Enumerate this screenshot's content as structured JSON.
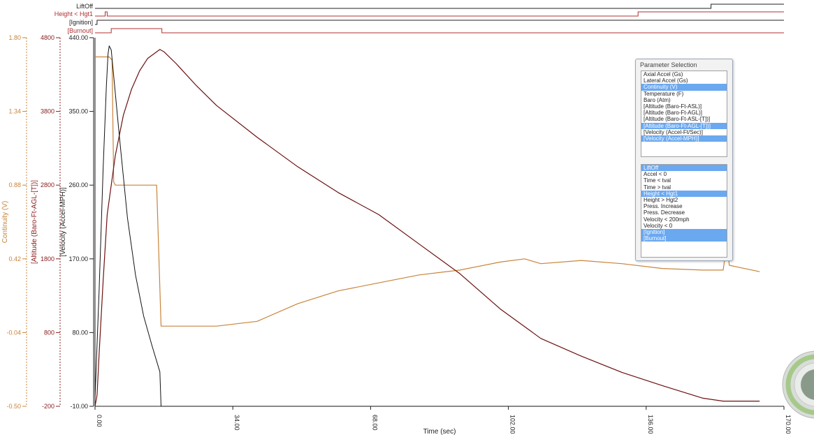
{
  "events": [
    {
      "label": "LiftOff",
      "color": "#222222"
    },
    {
      "label": "Height < Hgt1",
      "color": "#b03030"
    },
    {
      "label": "[Ignition]",
      "color": "#222222"
    },
    {
      "label": "[Burnout]",
      "color": "#b03030"
    }
  ],
  "chart_data": {
    "type": "line",
    "xlabel": "Time (sec)",
    "xlim": [
      0,
      170
    ],
    "xticks": [
      "0.00",
      "34.00",
      "68.00",
      "102.00",
      "136.00",
      "170.00"
    ],
    "axes": [
      {
        "name": "Continuity (V)",
        "color": "#c8843a",
        "ylim": [
          -0.5,
          1.8
        ],
        "ticks": [
          "-0.50",
          "-0.04",
          "0.42",
          "0.88",
          "1.34",
          "1.80"
        ]
      },
      {
        "name": "[Altitude (Baro-Ft-AGL-[T])]",
        "color": "#8b2020",
        "ylim": [
          -200,
          4800
        ],
        "ticks": [
          "-200",
          "800",
          "1800",
          "2800",
          "3800",
          "4800"
        ]
      },
      {
        "name": "[Velocity (Accel-MPH)]",
        "color": "#222222",
        "ylim": [
          -10,
          440
        ],
        "ticks": [
          "-10.00",
          "80.00",
          "170.00",
          "260.00",
          "350.00",
          "440.00"
        ]
      }
    ],
    "series": [
      {
        "name": "Continuity (V)",
        "axis": 0,
        "color": "#c8843a",
        "x": [
          0,
          3.5,
          4.2,
          4.6,
          5,
          15.2,
          16.3,
          20,
          30,
          40,
          50,
          60,
          70,
          80,
          90,
          100,
          106,
          110,
          120,
          130,
          140,
          150,
          155,
          156,
          156.5,
          164
        ],
        "y": [
          1.68,
          1.68,
          1.66,
          0.9,
          0.88,
          0.88,
          0.0,
          0.0,
          0.0,
          0.03,
          0.14,
          0.22,
          0.27,
          0.32,
          0.35,
          0.4,
          0.42,
          0.39,
          0.41,
          0.39,
          0.36,
          0.35,
          0.35,
          0.53,
          0.38,
          0.34
        ]
      },
      {
        "name": "[Altitude (Baro-Ft-AGL-[T])]",
        "axis": 1,
        "x": [
          0,
          0.5,
          1,
          2,
          3,
          5,
          7,
          9,
          11,
          13,
          15,
          16,
          17,
          20,
          25,
          30,
          40,
          50,
          60,
          70,
          80,
          90,
          100,
          110,
          120,
          130,
          140,
          150,
          155,
          164
        ],
        "y": [
          -200,
          -50,
          500,
          1500,
          2400,
          3200,
          3750,
          4100,
          4350,
          4520,
          4600,
          4640,
          4610,
          4450,
          4150,
          3880,
          3450,
          3050,
          2700,
          2400,
          2000,
          1600,
          1120,
          720,
          480,
          260,
          80,
          -90,
          -130,
          -130
        ],
        "color": "#6b1010"
      },
      {
        "name": "[Velocity (Accel-MPH)]",
        "axis": 2,
        "x": [
          0,
          1,
          2,
          2.8,
          3.2,
          3.5,
          4,
          6,
          8,
          10,
          12,
          14,
          16,
          16.3,
          17,
          30,
          50,
          100,
          150,
          164
        ],
        "y": [
          0,
          130,
          280,
          380,
          420,
          430,
          425,
          320,
          220,
          150,
          100,
          65,
          32,
          -10,
          -10,
          -10,
          -10,
          -10,
          -10,
          -10
        ],
        "color": "#111111"
      }
    ]
  },
  "panel": {
    "title": "Parameter Selection",
    "list_a": [
      {
        "label": "Axial Accel (Gs)",
        "selected": false
      },
      {
        "label": "Lateral Accel (Gs)",
        "selected": false
      },
      {
        "label": "Continuity (V)",
        "selected": true
      },
      {
        "label": "Temperature (F)",
        "selected": false
      },
      {
        "label": "Baro (Atm)",
        "selected": false
      },
      {
        "label": "[Altitude (Baro-Ft-ASL)]",
        "selected": false
      },
      {
        "label": "[Altitude (Baro-Ft-AGL)]",
        "selected": false
      },
      {
        "label": "[Altitude (Baro-Ft-ASL-[T])]",
        "selected": false
      },
      {
        "label": "[Altitude (Baro-Ft-AGL-[T])]",
        "selected": true
      },
      {
        "label": "[Velocity (Accel-Ft/Sec)]",
        "selected": false
      },
      {
        "label": "[Velocity (Accel-MPH)]",
        "selected": true
      }
    ],
    "list_b": [
      {
        "label": "LiftOff",
        "selected": true
      },
      {
        "label": "Accel < 0",
        "selected": false
      },
      {
        "label": "Time < tval",
        "selected": false
      },
      {
        "label": "Time > tval",
        "selected": false
      },
      {
        "label": "Height < Hgt1",
        "selected": true
      },
      {
        "label": "Height > Hgt2",
        "selected": false
      },
      {
        "label": "Press. Increase",
        "selected": false
      },
      {
        "label": "Press. Decrease",
        "selected": false
      },
      {
        "label": "Velocity < 200mph",
        "selected": false
      },
      {
        "label": "Velocity < 0",
        "selected": false
      },
      {
        "label": "[Ignition]",
        "selected": true
      },
      {
        "label": "[Burnout]",
        "selected": true
      }
    ]
  }
}
